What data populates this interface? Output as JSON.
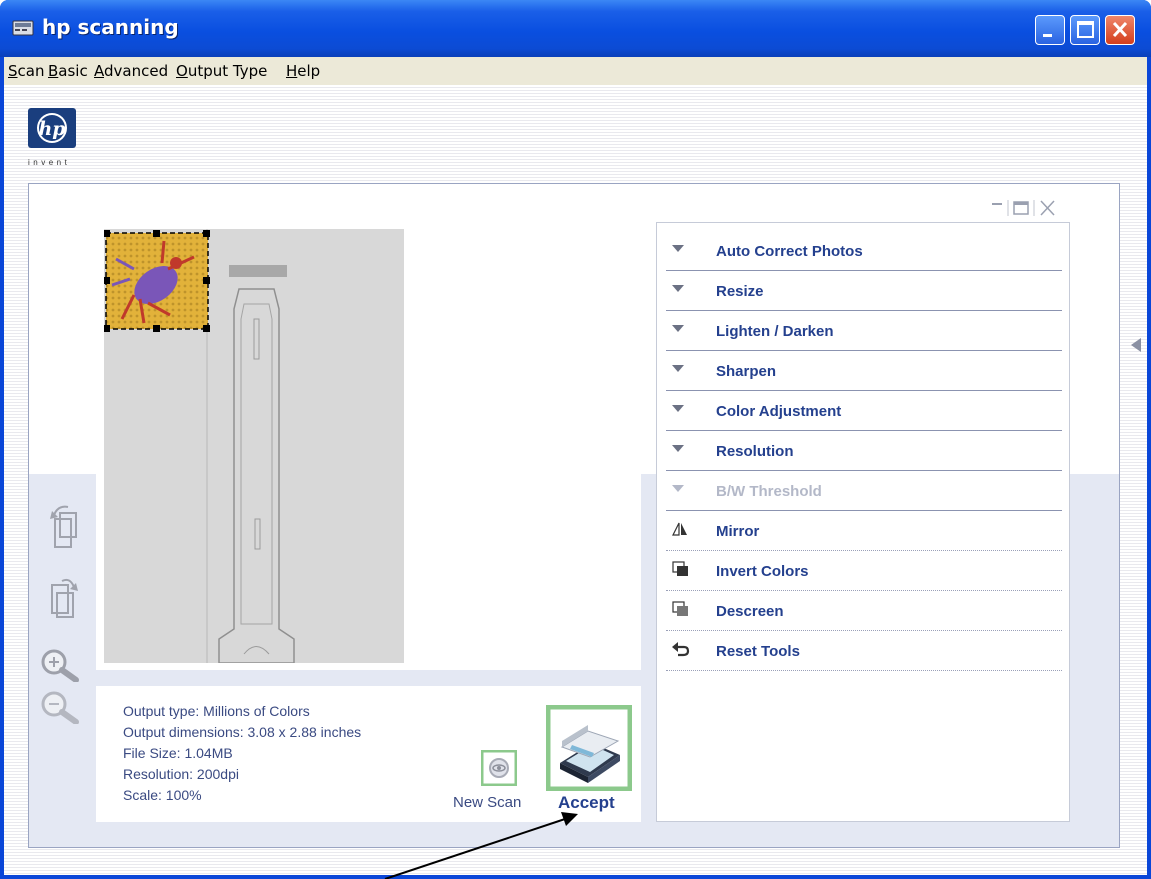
{
  "window": {
    "title": "hp scanning",
    "icon": "scanner-app-icon",
    "controls": [
      "minimize-icon",
      "maximize-icon",
      "close-icon"
    ]
  },
  "menu": {
    "items": [
      {
        "label": "Scan",
        "mnemonic": "S"
      },
      {
        "label": "Basic",
        "mnemonic": "B"
      },
      {
        "label": "Advanced",
        "mnemonic": "A"
      },
      {
        "label": "Output Type",
        "mnemonic": "O"
      },
      {
        "label": "Help",
        "mnemonic": "H"
      }
    ]
  },
  "brand": {
    "logo_text": "hp",
    "tagline": "invent"
  },
  "preview": {
    "image": "scanned-frog-preview",
    "selection": "crop-selection-frame"
  },
  "left_tools": [
    "rotate-left-icon",
    "rotate-right-icon",
    "zoom-in-icon",
    "zoom-out-icon"
  ],
  "info": {
    "output_type": "Output type: Millions of Colors",
    "output_dimensions": "Output dimensions: 3.08 x 2.88 inches",
    "file_size": "File Size: 1.04MB",
    "resolution": "Resolution:  200dpi",
    "scale": "Scale: 100%"
  },
  "actions": {
    "new_scan": "New Scan",
    "accept": "Accept"
  },
  "tools": [
    {
      "label": "Auto Correct Photos",
      "icon": "expand-triangle-icon",
      "enabled": true
    },
    {
      "label": "Resize",
      "icon": "expand-triangle-icon",
      "enabled": true
    },
    {
      "label": "Lighten / Darken",
      "icon": "expand-triangle-icon",
      "enabled": true
    },
    {
      "label": "Sharpen",
      "icon": "expand-triangle-icon",
      "enabled": true
    },
    {
      "label": "Color Adjustment",
      "icon": "expand-triangle-icon",
      "enabled": true
    },
    {
      "label": "Resolution",
      "icon": "expand-triangle-icon",
      "enabled": true
    },
    {
      "label": "B/W Threshold",
      "icon": "expand-triangle-icon",
      "enabled": false
    },
    {
      "label": "Mirror",
      "icon": "mirror-icon",
      "enabled": true
    },
    {
      "label": "Invert Colors",
      "icon": "invert-colors-icon",
      "enabled": true
    },
    {
      "label": "Descreen",
      "icon": "descreen-icon",
      "enabled": true
    },
    {
      "label": "Reset Tools",
      "icon": "reset-arrow-icon",
      "enabled": true
    }
  ],
  "colors": {
    "title_bar": "#0a4fe0",
    "tool_text": "#24408e",
    "info_text": "#3a4a82",
    "highlight_frame": "#8cc98c"
  }
}
